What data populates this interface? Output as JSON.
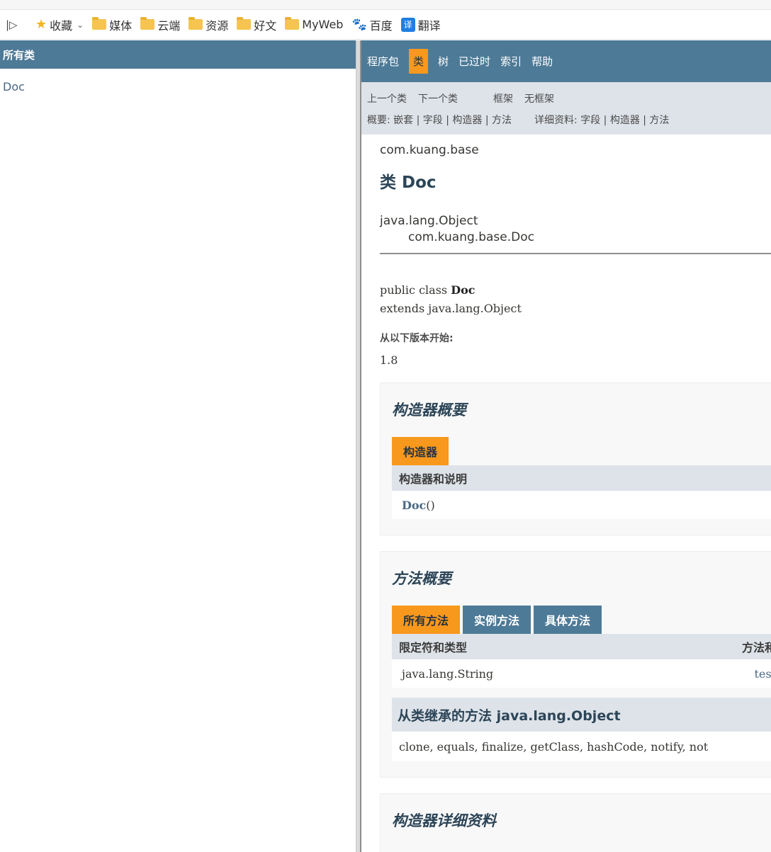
{
  "bookmarks": {
    "items": [
      {
        "label": "收藏",
        "icon": "star-folder-icon"
      },
      {
        "label": "媒体",
        "icon": "folder-icon"
      },
      {
        "label": "云端",
        "icon": "folder-icon"
      },
      {
        "label": "资源",
        "icon": "folder-icon"
      },
      {
        "label": "好文",
        "icon": "folder-icon"
      },
      {
        "label": "MyWeb",
        "icon": "folder-icon"
      },
      {
        "label": "百度",
        "icon": "baidu-paw-icon"
      },
      {
        "label": "翻译",
        "icon": "translate-icon"
      }
    ]
  },
  "left": {
    "header": "所有类",
    "classes": [
      "Doc"
    ]
  },
  "nav": {
    "items": [
      "程序包",
      "类",
      "树",
      "已过时",
      "索引",
      "帮助"
    ],
    "prev_class": "上一个类",
    "next_class": "下一个类",
    "frames": "框架",
    "no_frames": "无框架",
    "summary_row": "概要: 嵌套 | 字段 | 构造器 | 方法",
    "detail_row": "详细资料: 字段 | 构造器 | 方法"
  },
  "doc": {
    "package": "com.kuang.base",
    "title": "类 Doc",
    "inherit_root": "java.lang.Object",
    "inherit_child": "com.kuang.base.Doc",
    "sig_line1_prefix": "public class ",
    "sig_line1_name": "Doc",
    "sig_line2": "extends java.lang.Object",
    "since_label": "从以下版本开始:",
    "since_value": "1.8"
  },
  "constructor_summary": {
    "title": "构造器概要",
    "tab": "构造器",
    "header": "构造器和说明",
    "row_name": "Doc",
    "row_parens": "()"
  },
  "method_summary": {
    "title": "方法概要",
    "tabs": [
      "所有方法",
      "实例方法",
      "具体方法"
    ],
    "col_type": "限定符和类型",
    "col_method": "方法和",
    "row_type": "java.lang.String",
    "row_method": "test",
    "inherited_title": "从类继承的方法 java.lang.Object",
    "inherited_list": "clone, equals, finalize, getClass, hashCode, notify, not"
  },
  "constructor_detail": {
    "title": "构造器详细资料"
  }
}
